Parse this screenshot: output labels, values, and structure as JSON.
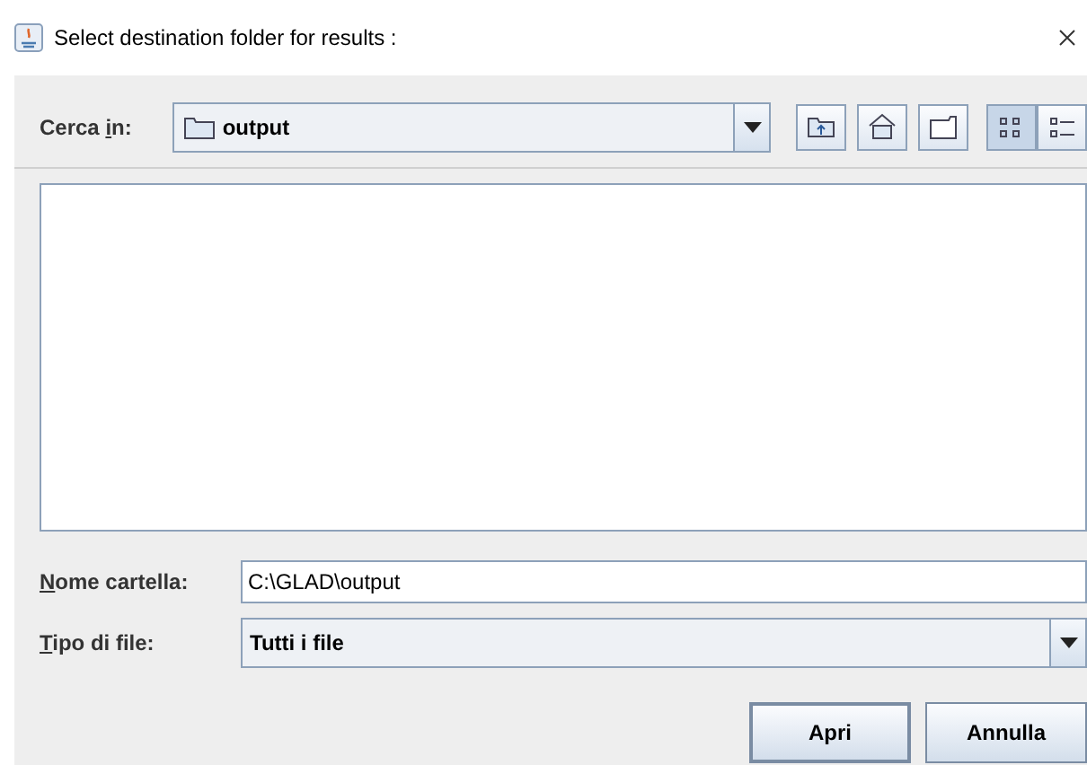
{
  "window": {
    "title": "Select destination folder for results :"
  },
  "look_in": {
    "label": [
      {
        "text": "Cerca ",
        "underlined": false
      },
      {
        "text": "i",
        "underlined": true
      },
      {
        "text": "n:",
        "underlined": false
      }
    ],
    "value": "output"
  },
  "toolbar": [
    {
      "kind": "up"
    },
    {
      "kind": "home"
    },
    {
      "kind": "new-folder"
    },
    {
      "kind": "list-view",
      "selected": true
    },
    {
      "kind": "details-view",
      "selected": false
    }
  ],
  "folder_name": {
    "label": [
      {
        "text": "N",
        "underlined": true
      },
      {
        "text": "ome cartella:",
        "underlined": false
      }
    ],
    "value": "C:\\GLAD\\output"
  },
  "file_type": {
    "label": [
      {
        "text": "T",
        "underlined": true
      },
      {
        "text": "ipo di file:",
        "underlined": false
      }
    ],
    "value": "Tutti i file"
  },
  "buttons": [
    "Apri",
    "Annulla"
  ]
}
